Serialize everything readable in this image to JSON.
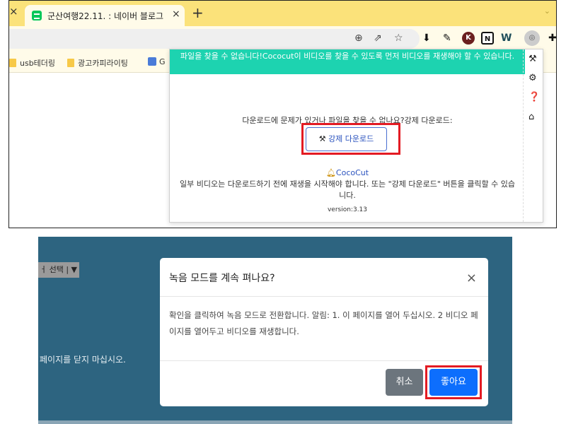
{
  "browser": {
    "tab_title": "군산여행22.11. : 네이버 블로그",
    "tab_close": "×",
    "left_close": "×",
    "new_tab": "+",
    "tab_menu": "⌄",
    "toolbar_icons": [
      "zoom-icon",
      "share-icon",
      "star-icon",
      "download-ext-icon",
      "pen-ext-icon",
      "k-ext-icon",
      "notion-ext-icon",
      "w-ext-icon",
      "cococut-ext-icon",
      "puzzle-icon"
    ]
  },
  "bookmarks": [
    {
      "label": "usb테더링"
    },
    {
      "label": "광고카피라이팅"
    },
    {
      "label": "G"
    }
  ],
  "popup": {
    "alert": "파일을 찾을 수 없습니다!Cococut이 비디오를 찾을 수 있도록 먼저 비디오를 재생해야 할 수 있습니다.",
    "download_question": "다운로드에 문제가 있거나 파일을 찾을 수 없나요?강제 다운로드:",
    "force_download": "강제 다운로드",
    "brand": "CocoCut",
    "description": "일부 비디오는 다운로드하기 전에 재생을 시작해야 합니다. 또는 \"강제 다운로드\" 버튼을 클릭할 수 있습니다.",
    "version": "version:3.13",
    "side_icons": [
      "hammer-icon",
      "gear-icon",
      "help-icon",
      "home-icon"
    ]
  },
  "recorder": {
    "select_label": "ㅓ 선택 | ▼",
    "bg_text": "페이지를 닫지 마십시오.",
    "modal": {
      "title": "녹음 모드를 계속 펴나요?",
      "close": "×",
      "body": "확인을 클릭하여 녹음 모드로 전환합니다. 알림: 1. 이 페이지를 열어 두십시오. 2 비디오 페이지를 열어두고 비디오를 재생합니다.",
      "cancel": "취소",
      "ok": "좋아요"
    }
  },
  "colors": {
    "tab_bar": "#fbe27a",
    "alert_bg": "#1dd3b0",
    "highlight": "#e31b23",
    "ok_button": "#0d6efd",
    "backdrop": "#2d6480"
  }
}
